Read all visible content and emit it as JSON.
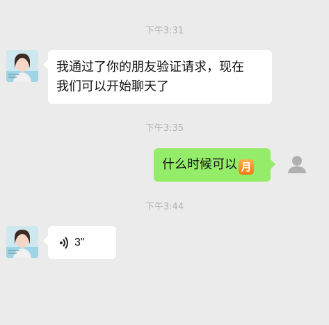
{
  "messages": [
    {
      "time": "下午3:31",
      "sender": "friend",
      "type": "text",
      "lines": [
        "我通过了你的朋友验证请求，现在",
        "我们可以开始聊天了"
      ]
    },
    {
      "time": "下午3:35",
      "sender": "me",
      "type": "text",
      "text": "什么时候可以",
      "emoji": "月"
    },
    {
      "time": "下午3:44",
      "sender": "friend",
      "type": "voice",
      "duration": "3\""
    }
  ],
  "colors": {
    "background": "#ebebeb",
    "incoming_bubble": "#ffffff",
    "outgoing_bubble": "#95ec69",
    "timestamp": "#b2b2b2"
  },
  "icons": {
    "friend_avatar": "photo-avatar",
    "my_avatar": "default-person-icon",
    "voice": "voice-wave-icon"
  }
}
